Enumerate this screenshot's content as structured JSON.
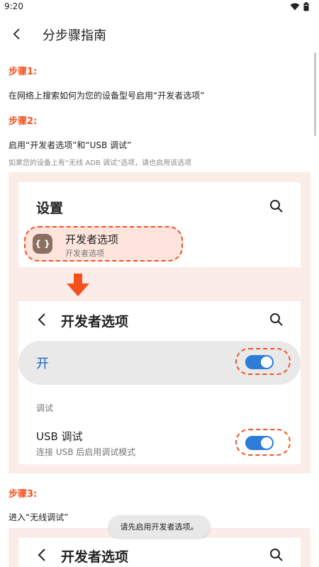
{
  "status_bar": {
    "time": "9:20",
    "icons": [
      "wifi-icon",
      "battery-icon"
    ]
  },
  "header": {
    "back_icon": "back-arrow-icon",
    "title": "分步骤指南"
  },
  "steps": [
    {
      "title": "步骤1:",
      "text": "在网络上搜索如何为您的设备型号启用“开发者选项”"
    },
    {
      "title": "步骤2:",
      "text": "启用“开发者选项”和“USB 调试”",
      "note": "如果您的设备上有“无线 ADB 调试”选项，请也启用该选项"
    },
    {
      "title": "步骤3:",
      "text": "进入“无线调试”"
    }
  ],
  "illustration_1": {
    "settings_title": "设置",
    "developer_item": {
      "label": "开发者选项",
      "sub": "开发者选项",
      "icon_glyph": "{ }"
    },
    "developer_screen": {
      "title": "开发者选项",
      "on_label": "开",
      "section_label": "调试",
      "usb_debug_label": "USB 调试",
      "usb_debug_sub": "连接 USB 后启用调试模式"
    }
  },
  "illustration_2": {
    "title": "开发者选项"
  },
  "toast": "请先启用开发者选项。",
  "colors": {
    "accent_orange": "#f4511e",
    "toggle_blue": "#2e7bd8",
    "illustration_bg": "#fbece7",
    "on_label_blue": "#1565c0"
  }
}
